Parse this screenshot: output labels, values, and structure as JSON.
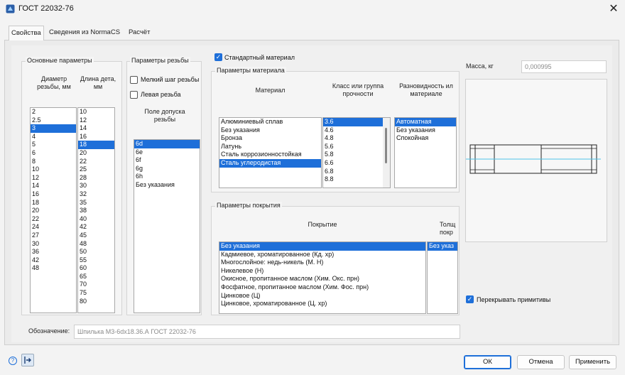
{
  "window": {
    "title": "ГОСТ 22032-76",
    "close_glyph": "✕"
  },
  "tabs": [
    {
      "label": "Свойства"
    },
    {
      "label": "Сведения из NormaCS"
    },
    {
      "label": "Расчёт"
    }
  ],
  "main_params": {
    "group_label": "Основные параметры",
    "diameter_header": "Диаметр\nрезьбы, мм",
    "length_header": "Длина дета,\nмм",
    "diameters": [
      "2",
      "2.5",
      "3",
      "4",
      "5",
      "6",
      "8",
      "10",
      "12",
      "14",
      "16",
      "18",
      "20",
      "22",
      "24",
      "27",
      "30",
      "36",
      "42",
      "48"
    ],
    "diameter_selected": "3",
    "lengths": [
      "10",
      "12",
      "14",
      "16",
      "18",
      "20",
      "22",
      "25",
      "28",
      "30",
      "32",
      "35",
      "38",
      "40",
      "42",
      "45",
      "48",
      "50",
      "55",
      "60",
      "65",
      "70",
      "75",
      "80"
    ],
    "length_selected": "18"
  },
  "thread_params": {
    "group_label": "Параметры резьбы",
    "fine_pitch_label": "Мелкий шаг резьбы",
    "left_thread_label": "Левая резьба",
    "tolerance_header": "Поле допуска\nрезьбы",
    "tolerances": [
      "6d",
      "6e",
      "6f",
      "6g",
      "6h",
      "Без указания"
    ],
    "tolerance_selected": "6d"
  },
  "standard_material": {
    "label": "Стандартный материал",
    "checked": true
  },
  "material_params": {
    "group_label": "Параметры материала",
    "material_header": "Материал",
    "class_header": "Класс или группа\nпрочности",
    "variety_header": "Разновидность ил\nматериале",
    "materials": [
      "Алюминиевый сплав",
      "Без указания",
      "Бронза",
      "Латунь",
      "Сталь коррозионностойкая",
      "Сталь углеродистая"
    ],
    "material_selected": "Сталь углеродистая",
    "classes": [
      "3.6",
      "4.6",
      "4.8",
      "5.6",
      "5.8",
      "6.6",
      "6.8",
      "8.8"
    ],
    "class_selected": "3.6",
    "varieties": [
      "Автоматная",
      "Без указания",
      "Спокойная"
    ],
    "variety_selected": "Автоматная"
  },
  "coating_params": {
    "group_label": "Параметры покрытия",
    "coating_header": "Покрытие",
    "thickness_header": "Толщ\nпокр",
    "coatings": [
      "Без указания",
      "Кадмиевое, хроматированное (Кд. хр)",
      "Многослойное: недь-никель (М. Н)",
      "Никелевое (Н)",
      "Окисное, пропитанное маслом (Хим. Окс. прн)",
      "Фосфатное, пропитанное маслом (Хим. Фос. прн)",
      "Цинковое (Ц)",
      "Цинковое, хроматированное (Ц. хр)"
    ],
    "coating_selected": "Без указания",
    "thickness_values": [
      "Без указ"
    ],
    "thickness_selected": "Без указ"
  },
  "mass": {
    "label": "Масса, кг",
    "value": "0,000995"
  },
  "overlap_primitives": {
    "label": "Перекрывать примитивы",
    "checked": true
  },
  "designation": {
    "label": "Обозначение:",
    "value": "Шпилька М3-6dх18.36.А ГОСТ 22032-76"
  },
  "footer": {
    "help_glyph": "?",
    "ok_label": "ОК",
    "cancel_label": "Отмена",
    "apply_label": "Применить"
  },
  "colors": {
    "selection": "#1e6fd9",
    "accent": "#1e6fd9",
    "preview_axis": "#4fc3e8"
  }
}
